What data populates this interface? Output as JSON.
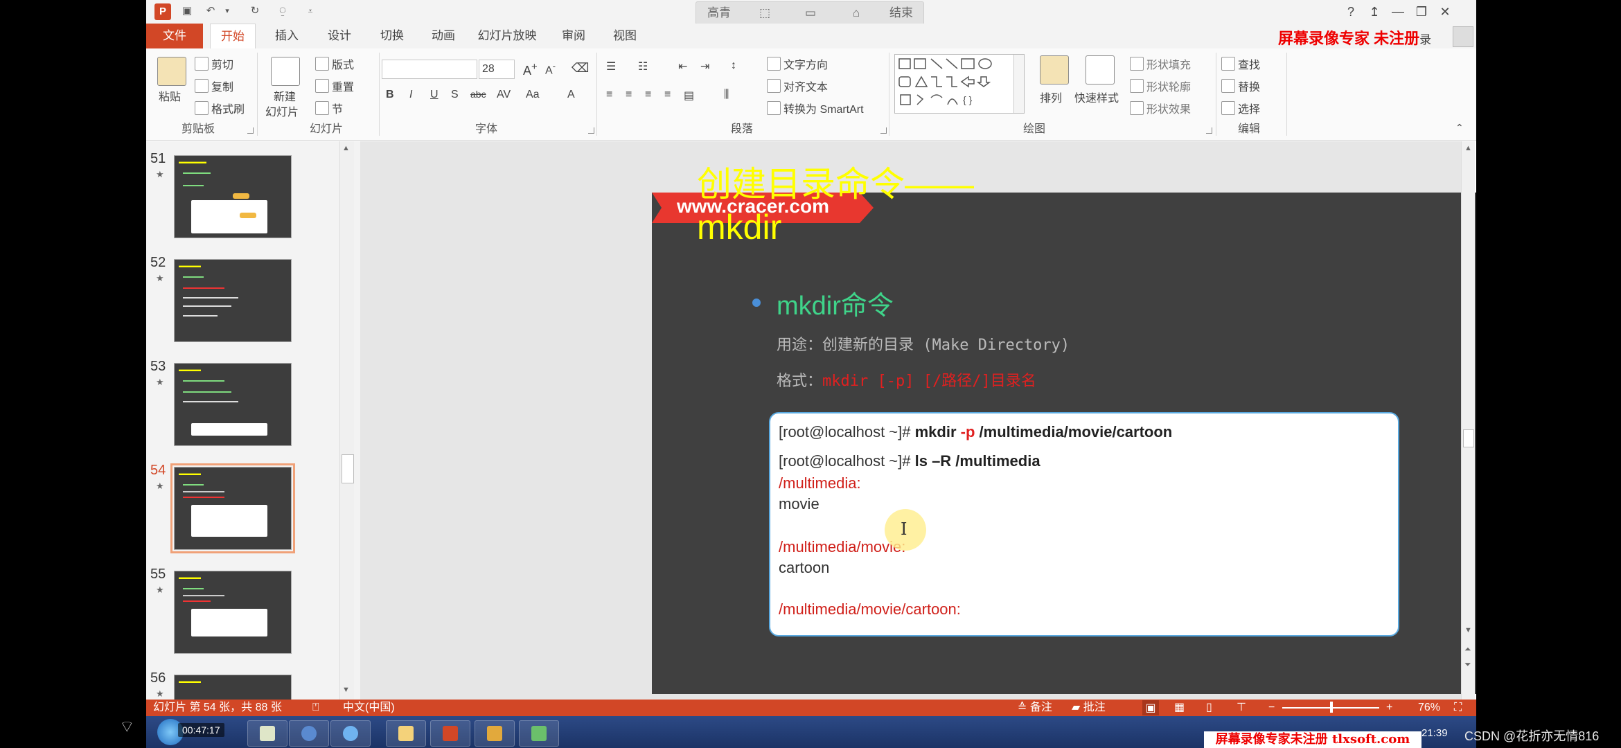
{
  "titlebar": {
    "center_buttons": [
      "高青",
      "",
      "",
      "",
      "结束"
    ],
    "window_buttons": [
      "?",
      "↥",
      "—",
      "❐",
      "✕"
    ]
  },
  "watermark_top": "屏幕录像专家 未注册",
  "login_suffix": "录",
  "tabs": [
    "文件",
    "开始",
    "插入",
    "设计",
    "切换",
    "动画",
    "幻灯片放映",
    "审阅",
    "视图"
  ],
  "ribbon": {
    "clipboard": {
      "paste": "粘贴",
      "cut": "剪切",
      "copy": "复制",
      "format_painter": "格式刷",
      "label": "剪贴板"
    },
    "slides": {
      "new_slide": "新建",
      "new_slide2": "幻灯片",
      "layout": "版式",
      "reset": "重置",
      "section": "节",
      "label": "幻灯片"
    },
    "font": {
      "name": "",
      "size": "28",
      "label": "字体"
    },
    "paragraph": {
      "text_direction": "文字方向",
      "align_text": "对齐文本",
      "smartart": "转换为 SmartArt",
      "label": "段落"
    },
    "drawing": {
      "arrange": "排列",
      "quick_styles": "快速样式",
      "shape_fill": "形状填充",
      "shape_outline": "形状轮廓",
      "shape_effects": "形状效果",
      "label": "绘图"
    },
    "editing": {
      "find": "查找",
      "replace": "替换",
      "select": "选择",
      "label": "编辑"
    }
  },
  "thumbnails": [
    {
      "num": "51",
      "selected": false
    },
    {
      "num": "52",
      "selected": false
    },
    {
      "num": "53",
      "selected": false
    },
    {
      "num": "54",
      "selected": true
    },
    {
      "num": "55",
      "selected": false
    },
    {
      "num": "56",
      "selected": false
    }
  ],
  "slide": {
    "title_line1": "创建目录命令——",
    "title_line2": "mkdir",
    "banner": "www.cracer.com",
    "bullet_head": "mkdir命令",
    "usage": "用途：创建新的目录 (Make Directory)",
    "format_label": "格式：",
    "format_cmd": "mkdir  [-p]  [/路径/]目录名",
    "code": {
      "l1_prompt": "[root@localhost ~]# ",
      "l1_cmd": "mkdir ",
      "l1_opt": "-p",
      "l1_path": " /multimedia/movie/cartoon",
      "l2_prompt": "[root@localhost ~]# ",
      "l2_cmd": "ls –R /multimedia",
      "l3": "/multimedia:",
      "l4": "movie",
      "l5": "/multimedia/movie:",
      "l6": "cartoon",
      "l7": "/multimedia/movie/cartoon:"
    }
  },
  "statusbar": {
    "slide_info": "幻灯片 第 54 张，共 88 张",
    "language": "中文(中国)",
    "notes": "备注",
    "comments": "批注",
    "zoom": "76%"
  },
  "taskbar": {
    "time_overlay": "00:47:17",
    "clock": "21:39"
  },
  "watermark_bottom": "屏幕录像专家未注册 tlxsoft.com",
  "csdn": "CSDN @花折亦无情816"
}
